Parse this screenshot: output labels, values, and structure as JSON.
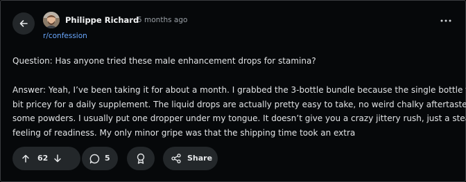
{
  "post": {
    "author": "Philippe Richard",
    "separator": "·",
    "time": "5 months ago",
    "community": "r/confession",
    "question": "Question: Has anyone tried these male enhancement drops for stamina?",
    "answer_lines": [
      "Answer: Yeah, I’ve been taking it for about a month. I grabbed the 3-bottle bundle because the single bottle felt a",
      "bit pricey for a daily supplement. The liquid drops are actually pretty easy to take, no weird chalky aftertaste like",
      "some powders. I usually put one dropper under my tongue. It doesn’t give you a crazy jittery rush, just a steady",
      "feeling of readiness. My only minor gripe was that the shipping time took an extra"
    ]
  },
  "actions": {
    "votes": "62",
    "comments": "5",
    "share_label": "Share"
  },
  "icons": {
    "back": "arrow-left-icon",
    "more": "more-horizontal-icon",
    "upvote": "arrow-up-icon",
    "downvote": "arrow-down-icon",
    "comment": "speech-bubble-icon",
    "award": "award-ribbon-icon",
    "share": "share-nodes-icon"
  },
  "colors": {
    "background": "#06080a",
    "pill": "#23272a",
    "link": "#6aa8ff",
    "text": "#e2e4e6"
  }
}
